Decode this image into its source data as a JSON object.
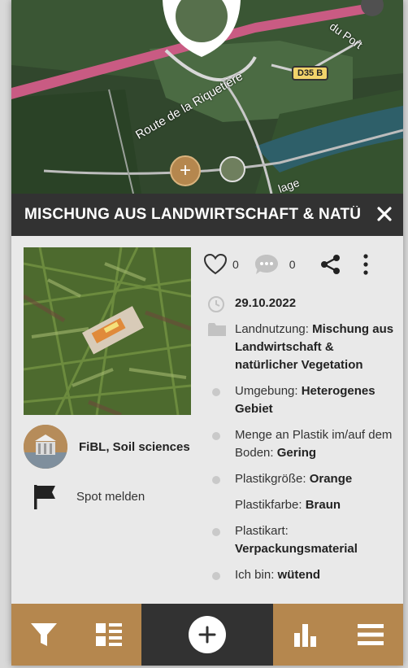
{
  "map": {
    "road_label_1": "Route de la Riquetière",
    "road_label_2": "du Port",
    "road_label_3": "lage",
    "road_badge": "D35 B",
    "add_marker": "+"
  },
  "detail": {
    "title": "MISCHUNG AUS LANDWIRTSCHAFT & NATÜRLICHER VEGETATION",
    "likes": "0",
    "comments": "0",
    "date": "29.10.2022",
    "land_use": {
      "label": "Landnutzung: ",
      "value": "Mischung aus Landwirtschaft & natürlicher Vegetation"
    },
    "surroundings": {
      "label": "Umgebung: ",
      "value": "Heterogenes Gebiet"
    },
    "amount": {
      "label": "Menge an Plastik im/auf dem Boden: ",
      "value": "Gering"
    },
    "size": {
      "label": "Plastikgröße: ",
      "value": "Orange"
    },
    "color": {
      "label": "Plastikfarbe: ",
      "value": "Braun"
    },
    "type": {
      "label": "Plastikart: ",
      "value": "Verpackungsmaterial"
    },
    "mood": {
      "label": "Ich bin: ",
      "value": "wütend"
    },
    "organization": "FiBL, Soil sciences",
    "report": "Spot melden"
  },
  "colors": {
    "brand_brown": "#b5874e",
    "dark_bar": "#323232",
    "content_bg": "#e9e9e9"
  },
  "nav": {
    "items": [
      "filter-icon",
      "list-icon",
      "add-icon",
      "stats-icon",
      "menu-icon"
    ]
  }
}
